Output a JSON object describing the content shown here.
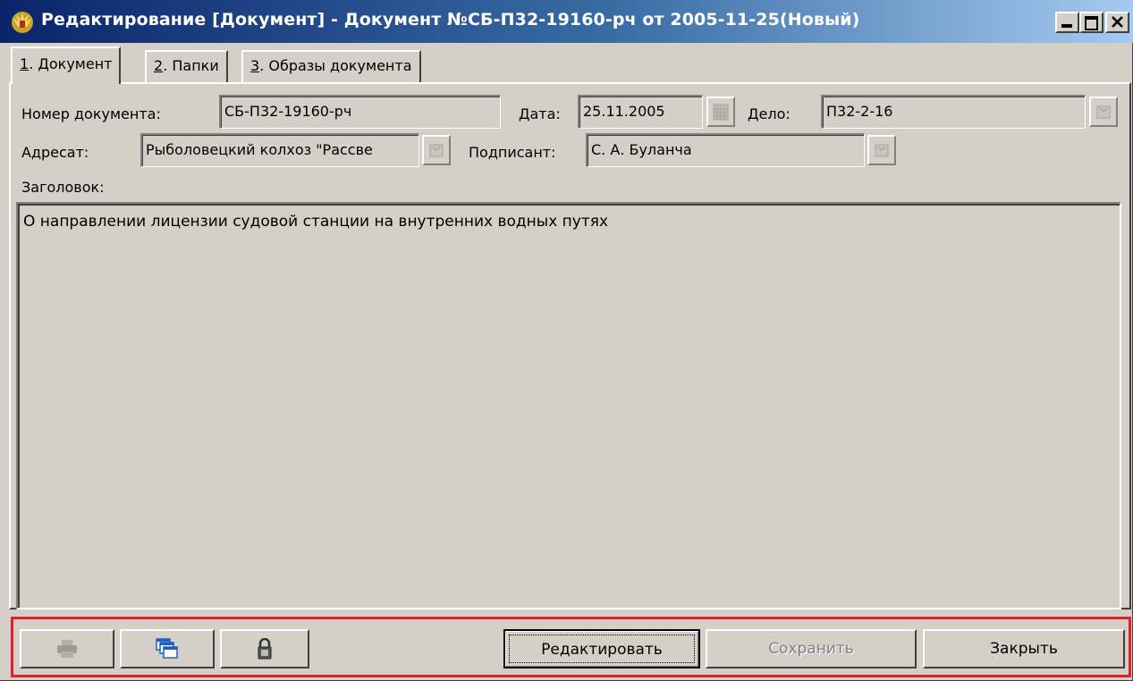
{
  "window": {
    "title": "Редактирование [Документ] - Документ №СБ-П32-19160-рч от 2005-11-25(Новый)"
  },
  "tabs": [
    {
      "key": "1",
      "label": ". Документ"
    },
    {
      "key": "2",
      "label": ". Папки"
    },
    {
      "key": "3",
      "label": ". Образы документа"
    }
  ],
  "form": {
    "doc_number_label": "Номер документа:",
    "doc_number_value": "СБ-П32-19160-рч",
    "date_label": "Дата:",
    "date_value": "25.11.2005",
    "case_label": "Дело:",
    "case_value": "П32-2-16",
    "addressee_label": "Адресат:",
    "addressee_value": "Рыболовецкий колхоз \"Рассве",
    "signer_label": "Подписант:",
    "signer_value": "С. А. Буланча",
    "heading_label": "Заголовок:",
    "heading_value": "О направлении лицензии судовой станции на внутренних водных путях"
  },
  "toolbar": {
    "print_icon": "printer-icon",
    "windows_icon": "windows-icon",
    "lock_icon": "lock-icon",
    "edit_label": "Редактировать",
    "save_label": "Сохранить",
    "close_label": "Закрыть"
  },
  "colors": {
    "title_bar_start": "#0a246a",
    "title_bar_end": "#a6caf0",
    "window_bg": "#d4d0c8",
    "highlight_frame": "#e0202a"
  }
}
